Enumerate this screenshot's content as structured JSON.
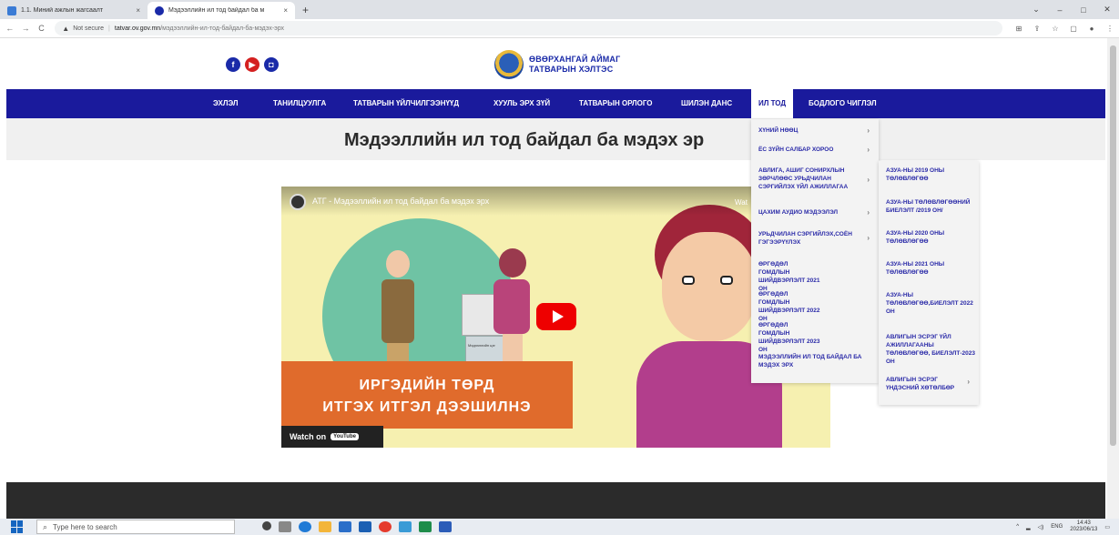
{
  "browser": {
    "tabs": [
      {
        "title": "1.1. Миний ажлын жагсаалт",
        "close": "×"
      },
      {
        "title": "Мэдээллийн ил тод байдал ба м",
        "close": "×"
      }
    ],
    "new_tab": "+",
    "window_controls": {
      "minimize": "–",
      "maximize": "□",
      "close": "✕",
      "tab_search": "⌄"
    },
    "address": {
      "security_icon": "warning-icon",
      "not_secure": "Not secure",
      "separator": "|",
      "host": "tatvar.ov.gov.mn",
      "path": "/мэдээллийн-ил-тод-байдал-ба-мэдэх-эрх"
    },
    "toolbar_icons": [
      "translate-icon",
      "share-icon",
      "star-icon",
      "sidebar-icon",
      "profile-icon",
      "menu-icon"
    ]
  },
  "header": {
    "social": [
      {
        "label": "f",
        "icon": "facebook-icon"
      },
      {
        "label": "▶",
        "icon": "youtube-icon"
      },
      {
        "label": "◘",
        "icon": "instagram-icon"
      }
    ],
    "brand_line1": "ӨВӨРХАНГАЙ АЙМАГ",
    "brand_line2": "ТАТВАРЫН ХЭЛТЭС"
  },
  "nav": {
    "items": [
      {
        "label": "ЭХЛЭЛ"
      },
      {
        "label": "ТАНИЛЦУУЛГА"
      },
      {
        "label": "ТАТВАРЫН ҮЙЛЧИЛГЭЭНҮҮД"
      },
      {
        "label": "ХУУЛЬ ЭРХ ЗҮЙ"
      },
      {
        "label": "ТАТВАРЫН ОРЛОГО"
      },
      {
        "label": "ШИЛЭН ДАНС"
      },
      {
        "label": "ИЛ ТОД"
      },
      {
        "label": "БОДЛОГО ЧИГЛЭЛ"
      }
    ],
    "active_index": 6
  },
  "page": {
    "title": "Мэдээллийн ил тод байдал ба мэдэх эр"
  },
  "video": {
    "title": "АТГ - Мэдээллийн ил тод байдал ба мэдэх эрх",
    "side_text": "Wat",
    "kiosk_label": "Мэдээллийн цэг",
    "banner_line1": "ИРГЭДИЙН ТӨРД",
    "banner_line2": "ИТГЭХ ИТГЭЛ ДЭЭШИЛНЭ",
    "watch_on": "Watch on",
    "youtube": "YouTube"
  },
  "dropdown1": [
    {
      "label": "ХҮНИЙ НӨӨЦ",
      "chevron": "›"
    },
    {
      "label": "ЁС ЗҮЙН САЛБАР ХОРОО",
      "chevron": "›"
    },
    {
      "label": "АВЛИГА, АШИГ СОНИРХЛЫН ЗӨРЧЛӨӨС УРЬДЧИЛАН СЭРГИЙЛЭХ ҮЙЛ АЖИЛЛАГАА",
      "chevron": "›"
    },
    {
      "label": "ЦАХИМ АУДИО МЭДЭЭЛЭЛ",
      "chevron": "›"
    },
    {
      "label": "УРЬДЧИЛАН СЭРГИЙЛЭХ,СОЁН ГЭГЭЭРҮҮЛЭХ",
      "chevron": "›"
    },
    {
      "label": "ӨРГӨДӨЛ ГОМДЛЫН ШИЙДВЭРЛЭЛТ 2021 ОН",
      "chevron": ""
    },
    {
      "label": "ӨРГӨДӨЛ ГОМДЛЫН ШИЙДВЭРЛЭЛТ 2022 ОН",
      "chevron": ""
    },
    {
      "label": "ӨРГӨДӨЛ ГОМДЛЫН ШИЙДВЭРЛЭЛТ 2023 ОН",
      "chevron": ""
    },
    {
      "label": "МЭДЭЭЛЛИЙН ИЛ ТОД БАЙДАЛ БА МЭДЭХ ЭРХ",
      "chevron": ""
    }
  ],
  "dropdown2": [
    {
      "label": "АЗУА-НЫ 2019 ОНЫ ТӨЛӨВЛӨГӨӨ",
      "chevron": ""
    },
    {
      "label": "АЗУА-НЫ ТӨЛӨВЛӨГӨӨНИЙ БИЕЛЭЛТ /2019 ОН/",
      "chevron": ""
    },
    {
      "label": "АЗУА-НЫ 2020 ОНЫ ТӨЛӨВЛӨГӨӨ",
      "chevron": ""
    },
    {
      "label": "АЗУА-НЫ 2021 ОНЫ ТӨЛӨВЛӨГӨӨ",
      "chevron": ""
    },
    {
      "label": "АЗУА-НЫ ТӨЛӨВЛӨГӨӨ,БИЕЛЭЛТ 2022 ОН",
      "chevron": ""
    },
    {
      "label": "АВЛИГЫН ЭСРЭГ ҮЙЛ АЖИЛЛАГААНЫ ТӨЛӨВЛӨГӨӨ, БИЕЛЭЛТ-2023 ОН",
      "chevron": ""
    },
    {
      "label": "АВЛИГЫН ЭСРЭГ ҮНДЭСНИЙ ХӨТӨЛБӨР",
      "chevron": "›"
    }
  ],
  "taskbar": {
    "search_placeholder": "Type here to search",
    "lang": "ENG",
    "time": "14:43",
    "date": "2023/06/13"
  },
  "colors": {
    "nav_bg": "#1a1a9c",
    "brand_blue": "#1a2aa8",
    "menu_text": "#2a2aa8",
    "banner_orange": "#e06b2c",
    "footer": "#2b2b2b"
  }
}
